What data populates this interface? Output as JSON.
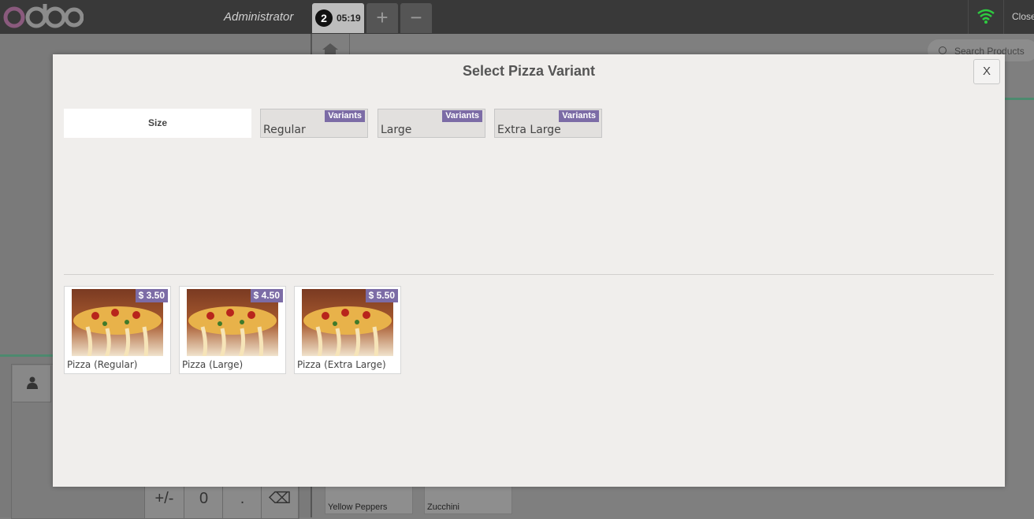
{
  "header": {
    "cashier": "Administrator",
    "order_number": "2",
    "order_time": "05:19",
    "add_order": "+",
    "remove_order": "−",
    "close_label": "Close"
  },
  "search": {
    "placeholder": "Search Products"
  },
  "numpad": {
    "sign": "+/-",
    "zero": "0",
    "dot": ".",
    "backspace": "⌫"
  },
  "background_products": [
    "Yellow Peppers",
    "Zucchini"
  ],
  "modal": {
    "title": "Select Pizza Variant",
    "close": "X",
    "attribute_label": "Size",
    "variants": [
      {
        "name": "Regular",
        "badge": "Variants"
      },
      {
        "name": "Large",
        "badge": "Variants"
      },
      {
        "name": "Extra Large",
        "badge": "Variants"
      }
    ],
    "products": [
      {
        "name": "Pizza (Regular)",
        "price": "$ 3.50"
      },
      {
        "name": "Pizza (Large)",
        "price": "$ 4.50"
      },
      {
        "name": "Pizza (Extra Large)",
        "price": "$ 5.50"
      }
    ]
  },
  "colors": {
    "accent": "#7c6ca6",
    "topbar": "#393939",
    "wifi": "#2ecc40",
    "logo": "#875a7b"
  }
}
